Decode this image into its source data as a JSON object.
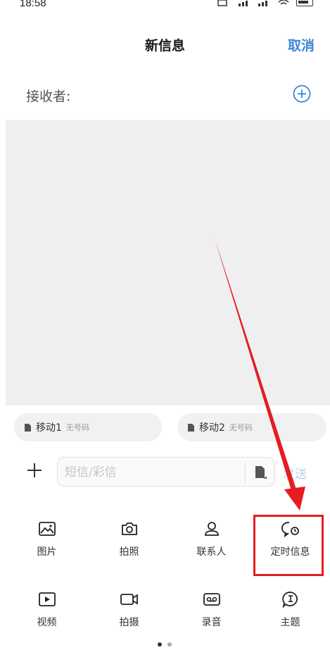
{
  "status_bar": {
    "time": "18:58"
  },
  "header": {
    "title": "新信息",
    "cancel_label": "取消"
  },
  "recipient": {
    "label": "接收者:"
  },
  "sim_cards": [
    {
      "name": "移动1",
      "sub": "无号码"
    },
    {
      "name": "移动2",
      "sub": "无号码"
    }
  ],
  "compose": {
    "placeholder": "短信/彩信",
    "send_label": "发送"
  },
  "tools_row1": [
    {
      "label": "图片",
      "icon": "image-icon"
    },
    {
      "label": "拍照",
      "icon": "camera-icon"
    },
    {
      "label": "联系人",
      "icon": "contact-icon"
    },
    {
      "label": "定时信息",
      "icon": "scheduled-message-icon"
    }
  ],
  "tools_row2": [
    {
      "label": "视频",
      "icon": "video-icon"
    },
    {
      "label": "拍摄",
      "icon": "video-camera-icon"
    },
    {
      "label": "录音",
      "icon": "recording-icon"
    },
    {
      "label": "主题",
      "icon": "theme-icon"
    }
  ],
  "colors": {
    "accent": "#3a86d6",
    "highlight": "#e51c23",
    "arrow": "#e51c23"
  }
}
